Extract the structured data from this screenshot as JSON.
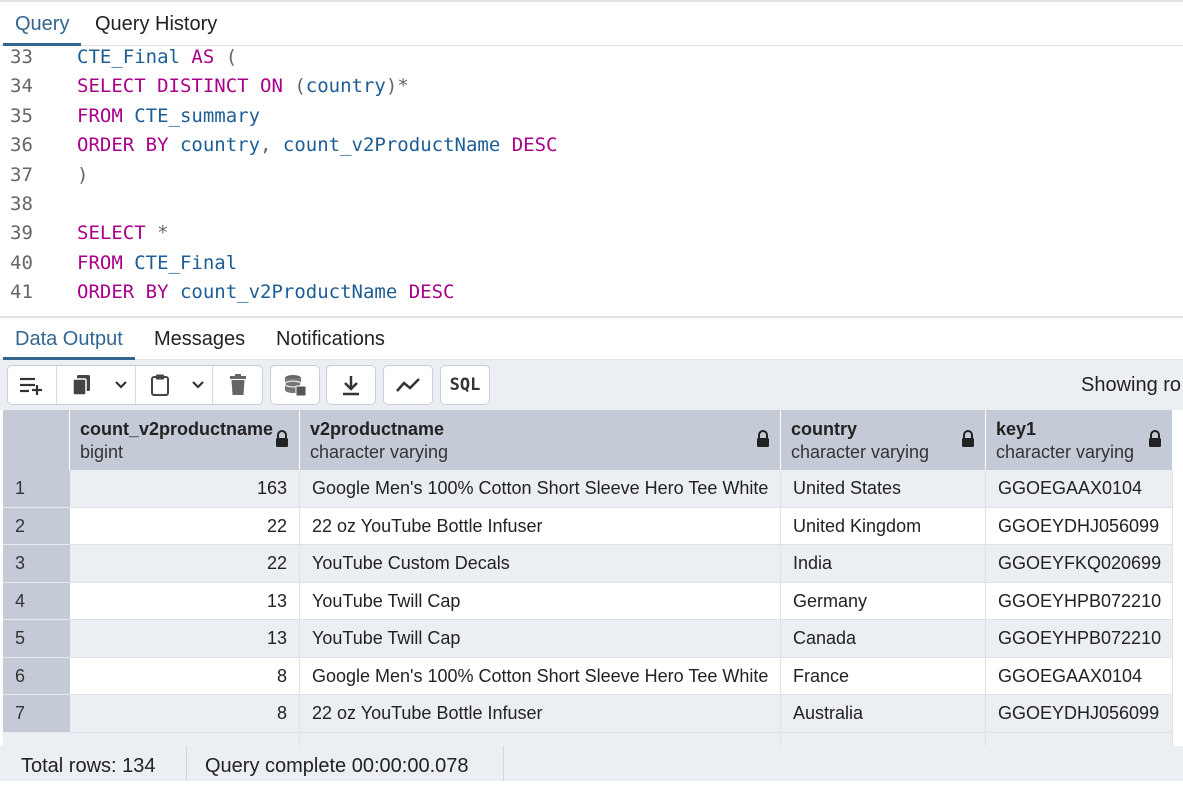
{
  "top_tabs": [
    "Query",
    "Query History"
  ],
  "editor": {
    "lines": [
      {
        "num": "33",
        "tokens": [
          [
            "id",
            "CTE_Final "
          ],
          [
            "kw",
            "AS"
          ],
          [
            "pn",
            " ("
          ]
        ]
      },
      {
        "num": "34",
        "tokens": [
          [
            "kw",
            "SELECT DISTINCT ON"
          ],
          [
            "pn",
            " ("
          ],
          [
            "id",
            "country"
          ],
          [
            "pn",
            ")*"
          ]
        ]
      },
      {
        "num": "35",
        "tokens": [
          [
            "kw",
            "FROM"
          ],
          [
            "id",
            " CTE_summary"
          ]
        ]
      },
      {
        "num": "36",
        "tokens": [
          [
            "kw",
            "ORDER BY"
          ],
          [
            "id",
            " country"
          ],
          [
            "pn",
            ", "
          ],
          [
            "id",
            "count_v2ProductName "
          ],
          [
            "kw",
            "DESC"
          ]
        ]
      },
      {
        "num": "37",
        "tokens": [
          [
            "pn",
            ")"
          ]
        ]
      },
      {
        "num": "38",
        "tokens": []
      },
      {
        "num": "39",
        "tokens": [
          [
            "kw",
            "SELECT"
          ],
          [
            "pn",
            " *"
          ]
        ]
      },
      {
        "num": "40",
        "tokens": [
          [
            "kw",
            "FROM"
          ],
          [
            "id",
            " CTE_Final"
          ]
        ]
      },
      {
        "num": "41",
        "tokens": [
          [
            "kw",
            "ORDER BY"
          ],
          [
            "id",
            " count_v2ProductName "
          ],
          [
            "kw",
            "DESC"
          ]
        ]
      }
    ]
  },
  "result_tabs": [
    "Data Output",
    "Messages",
    "Notifications"
  ],
  "toolbar": {
    "sql_label": "SQL",
    "showing_text": "Showing ro",
    "icons": [
      "add-row-icon",
      "copy-icon",
      "dropdown-icon",
      "paste-icon",
      "dropdown-icon",
      "delete-icon",
      "save-data-icon",
      "download-icon",
      "graph-icon",
      "sql-icon"
    ]
  },
  "grid": {
    "columns": [
      {
        "name": "count_v2productname",
        "type": "bigint"
      },
      {
        "name": "v2productname",
        "type": "character varying"
      },
      {
        "name": "country",
        "type": "character varying"
      },
      {
        "name": "key1",
        "type": "character varying"
      }
    ],
    "rows": [
      {
        "n": "1",
        "count": "163",
        "product": "Google Men's 100% Cotton Short Sleeve Hero Tee White",
        "country": "United States",
        "key": "GGOEGAAX0104"
      },
      {
        "n": "2",
        "count": "22",
        "product": "22 oz YouTube Bottle Infuser",
        "country": "United Kingdom",
        "key": "GGOEYDHJ056099"
      },
      {
        "n": "3",
        "count": "22",
        "product": "YouTube Custom Decals",
        "country": "India",
        "key": "GGOEYFKQ020699"
      },
      {
        "n": "4",
        "count": "13",
        "product": "YouTube Twill Cap",
        "country": "Germany",
        "key": "GGOEYHPB072210"
      },
      {
        "n": "5",
        "count": "13",
        "product": "YouTube Twill Cap",
        "country": "Canada",
        "key": "GGOEYHPB072210"
      },
      {
        "n": "6",
        "count": "8",
        "product": "Google Men's 100% Cotton Short Sleeve Hero Tee White",
        "country": "France",
        "key": "GGOEGAAX0104"
      },
      {
        "n": "7",
        "count": "8",
        "product": "22 oz YouTube Bottle Infuser",
        "country": "Australia",
        "key": "GGOEYDHJ056099"
      }
    ]
  },
  "status": {
    "total_rows": "Total rows: 134",
    "query_status": "Query complete 00:00:00.078"
  }
}
